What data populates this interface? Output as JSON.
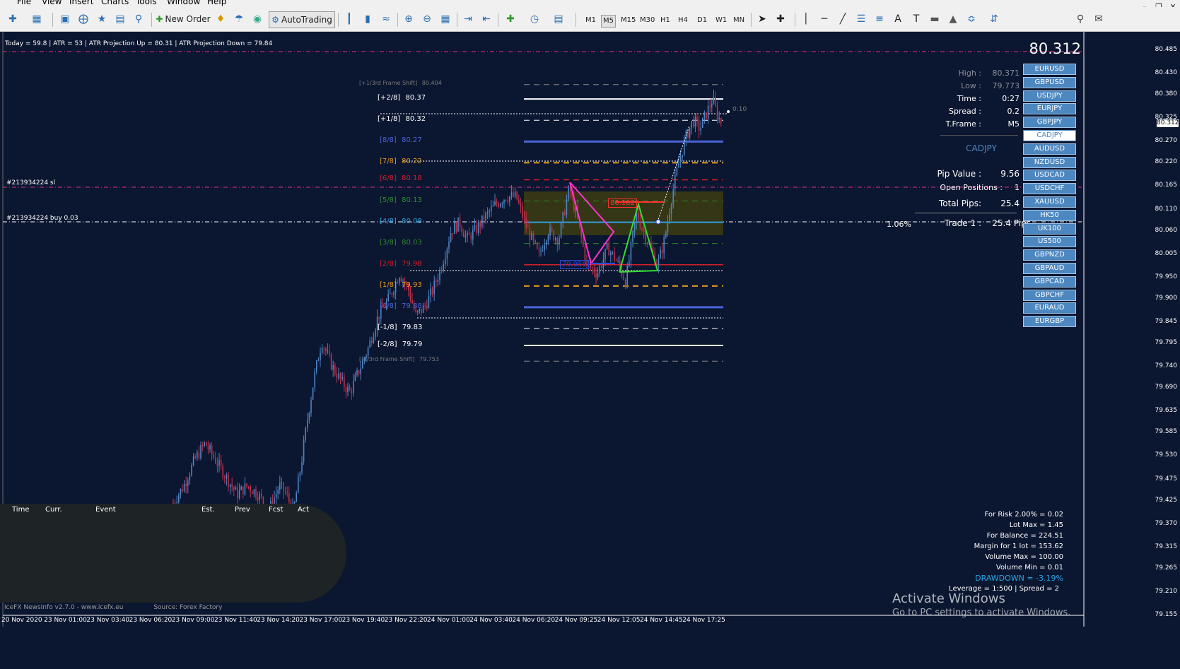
{
  "menu": {
    "items": [
      "File",
      "View",
      "Insert",
      "Charts",
      "Tools",
      "Window",
      "Help"
    ]
  },
  "toolbar": {
    "new_order_label": "New Order",
    "autotrading_label": "AutoTrading",
    "timeframes": [
      "M1",
      "M5",
      "M15",
      "M30",
      "H1",
      "H4",
      "D1",
      "W1",
      "MN"
    ],
    "active_timeframe": "M5"
  },
  "chart": {
    "info_line": "Today = 59.8   |   ATR = 53   |   ATR Projection Up = 80.31   |   ATR Projection Down = 79.84",
    "current_price": "80.312",
    "price_tag": "80.312",
    "countdown": "0:10",
    "sl_label": "#213934224 sl",
    "buy_label": "#213934224 buy 0.03",
    "pattern_label_red": "80.102",
    "pattern_label_blue": "79.959",
    "percent_label": "1.06%"
  },
  "murrey": [
    {
      "label": "[+1/3rd Frame Shift]",
      "value": "80.404",
      "color": "#7a7a7a"
    },
    {
      "label": "[+2/8]",
      "value": "80.37",
      "color": "#ffffff"
    },
    {
      "label": "[+1/8]",
      "value": "80.32",
      "color": "#ffffff"
    },
    {
      "label": "[8/8]",
      "value": "80.27",
      "color": "#4a63d8"
    },
    {
      "label": "[7/8]",
      "value": "80.22",
      "color": "#e59b1b"
    },
    {
      "label": "[6/8]",
      "value": "80.18",
      "color": "#d61d2a"
    },
    {
      "label": "[5/8]",
      "value": "80.13",
      "color": "#2e8b2e"
    },
    {
      "label": "[4/8]",
      "value": "80.08",
      "color": "#2f9fe0"
    },
    {
      "label": "[3/8]",
      "value": "80.03",
      "color": "#2e8b2e"
    },
    {
      "label": "[2/8]",
      "value": "79.98",
      "color": "#d61d2a"
    },
    {
      "label": "[1/8]",
      "value": "79.93",
      "color": "#e59b1b"
    },
    {
      "label": "[0/8]",
      "value": "79.88",
      "color": "#4a63d8"
    },
    {
      "label": "[-1/8]",
      "value": "79.83",
      "color": "#ffffff"
    },
    {
      "label": "[-2/8]",
      "value": "79.79",
      "color": "#ffffff"
    },
    {
      "label": "[-1/3rd Frame Shift]",
      "value": "79.753",
      "color": "#7a7a7a"
    }
  ],
  "info_panel": {
    "high_label": "High :",
    "high_value": "80.371",
    "low_label": "Low :",
    "low_value": "79.773",
    "time_label": "Time :",
    "time_value": "0:27",
    "spread_label": "Spread :",
    "spread_value": "0.2",
    "tframe_label": "T.Frame :",
    "tframe_value": "M5",
    "symbol": "CADJPY",
    "pip_value_label": "Pip Value :",
    "pip_value": "9.56",
    "open_positions_label": "Open Positions :",
    "open_positions": "1",
    "total_pips_label": "Total Pips:",
    "total_pips": "25.4",
    "trade_label": "Trade 1 :",
    "trade_value": "25.4 Pips"
  },
  "pairs": [
    "EURUSD",
    "GBPUSD",
    "USDJPY",
    "EURJPY",
    "GBPJPY",
    "CADJPY",
    "AUDUSD",
    "NZDUSD",
    "USDCAD",
    "USDCHF",
    "XAUUSD",
    "HK50",
    "UK100",
    "US500",
    "GBPNZD",
    "GBPAUD",
    "GBPCAD",
    "GBPCHF",
    "EURAUD",
    "EURGBP"
  ],
  "selected_pair": "CADJPY",
  "price_axis": [
    "80.485",
    "80.430",
    "80.380",
    "80.325",
    "80.270",
    "80.220",
    "80.165",
    "80.110",
    "80.060",
    "80.005",
    "79.950",
    "79.900",
    "79.845",
    "79.795",
    "79.740",
    "79.690",
    "79.635",
    "79.585",
    "79.530",
    "79.475",
    "79.425",
    "79.370",
    "79.315",
    "79.265",
    "79.210",
    "79.155"
  ],
  "time_axis": [
    "20 Nov 2020",
    "23 Nov 01:00",
    "23 Nov 03:40",
    "23 Nov 06:20",
    "23 Nov 09:00",
    "23 Nov 11:40",
    "23 Nov 14:20",
    "23 Nov 17:00",
    "23 Nov 19:40",
    "23 Nov 22:20",
    "24 Nov 01:00",
    "24 Nov 03:40",
    "24 Nov 06:20",
    "24 Nov 09:25",
    "24 Nov 12:05",
    "24 Nov 14:45",
    "24 Nov 17:25"
  ],
  "news": {
    "headers": [
      "Time",
      "Curr.",
      "Event",
      "Est.",
      "Prev",
      "Fcst",
      "Act"
    ],
    "footer_left": "IceFX NewsInfo v2.7.0  -  www.icefx.eu",
    "footer_right": "Source: Forex Factory"
  },
  "risk": {
    "lines": [
      "For Risk 2.00% = 0.02",
      "Lot Max = 1.45",
      "For Balance = 224.51",
      "Margin for 1 lot = 153.62",
      "Volume Max = 100.00",
      "Volume Min = 0.01",
      "DRAWDOWN = -3.19%",
      "Leverage = 1:500 | Spread = 2"
    ],
    "drawdown_color": "#2aa7e8"
  },
  "watermark": {
    "line1": "Activate Windows",
    "line2": "Go to PC settings to activate Windows."
  },
  "colors": {
    "background": "#0b1630",
    "bull": "#4f84c4",
    "bear": "#c0304a",
    "magenta": "#ff33cc",
    "pink_dash": "#e0328a",
    "green": "#33dd33"
  }
}
